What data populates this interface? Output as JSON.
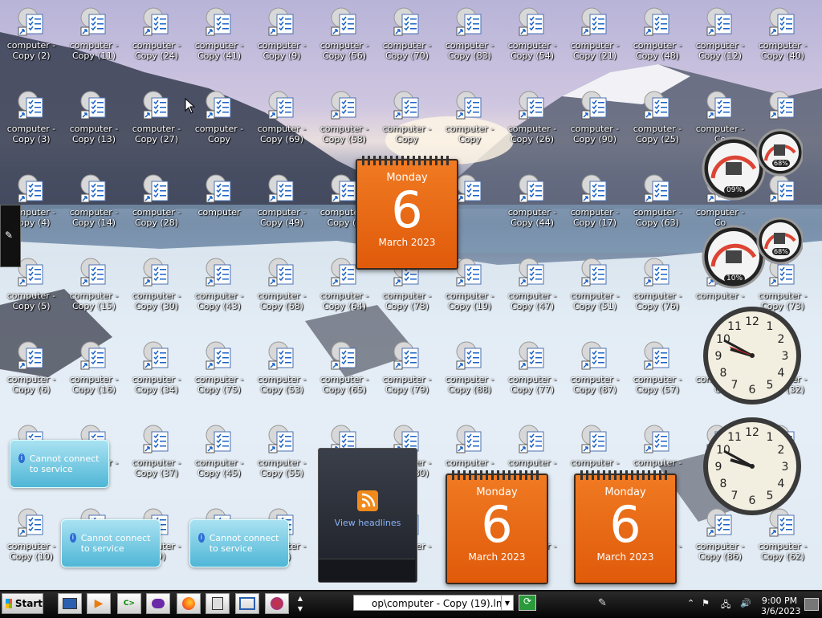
{
  "desktop": {
    "icons": [
      [
        "computer -\nCopy (2)",
        "computer -\nCopy (11)",
        "computer -\nCopy (24)",
        "computer -\nCopy (41)",
        "computer -\nCopy (9)",
        "computer -\nCopy (56)",
        "computer -\nCopy (70)",
        "computer -\nCopy (83)",
        "computer -\nCopy (54)",
        "computer -\nCopy (21)",
        "computer -\nCopy (48)",
        "computer -\nCopy (12)",
        "computer -\nCopy (40)"
      ],
      [
        "computer -\nCopy (3)",
        "computer -\nCopy (13)",
        "computer -\nCopy (27)",
        "computer -\nCopy",
        "computer -\nCopy (69)",
        "computer -\nCopy (58)",
        "computer -\nCopy",
        "computer -\nCopy",
        "computer -\nCopy (26)",
        "computer -\nCopy (90)",
        "computer -\nCopy (25)",
        "computer -\nCo",
        ""
      ],
      [
        "computer -\nCopy (4)",
        "computer -\nCopy (14)",
        "computer -\nCopy (28)",
        "computer",
        "computer -\nCopy (49)",
        "computer -\nCopy (5",
        "",
        "",
        "computer -\nCopy (44)",
        "computer -\nCopy (17)",
        "computer -\nCopy (63)",
        "computer -\nCo",
        ""
      ],
      [
        "computer -\nCopy (5)",
        "computer -\nCopy (15)",
        "computer -\nCopy (30)",
        "computer -\nCopy (43)",
        "computer -\nCopy (68)",
        "computer -\nCopy (64)",
        "computer -\nCopy (78)",
        "computer -\nCopy (19)",
        "computer -\nCopy (47)",
        "computer -\nCopy (51)",
        "computer -\nCopy (76)",
        "computer -\n",
        "computer -\nCopy (73)"
      ],
      [
        "computer -\nCopy (6)",
        "computer -\nCopy (16)",
        "computer -\nCopy (34)",
        "computer -\nCopy (75)",
        "computer -\nCopy (53)",
        "computer -\nCopy (65)",
        "computer -\nCopy (79)",
        "computer -\nCopy (88)",
        "computer -\nCopy (77)",
        "computer -\nCopy (87)",
        "computer -\nCopy (57)",
        "computer -\nCo",
        "computer -\nCopy (32)"
      ],
      [
        "",
        "computer -\n8)",
        "computer -\nCopy (37)",
        "computer -\nCopy (45)",
        "computer -\nCopy (55)",
        "",
        "computer -\nCopy (80)",
        "computer -\n",
        "computer -\n",
        "computer -\n",
        "computer -\n",
        "",
        ""
      ],
      [
        "computer -\nCopy (10)",
        "",
        "computer -\n(39)",
        "",
        "computer -\n(42)",
        "",
        "computer -\n(31)",
        "",
        "computer -\n2)",
        "",
        "computer -\n",
        "computer -\nCopy (86)",
        "computer -\nCopy (62)"
      ]
    ]
  },
  "calendars": [
    {
      "day_name": "Monday",
      "day": "6",
      "month_year": "March 2023"
    },
    {
      "day_name": "Monday",
      "day": "6",
      "month_year": "March 2023"
    },
    {
      "day_name": "Monday",
      "day": "6",
      "month_year": "March 2023"
    }
  ],
  "meters": [
    {
      "cpu": "09%",
      "mem": "68%"
    },
    {
      "cpu": "10%",
      "mem": "68%"
    }
  ],
  "notices": [
    "Cannot connect to service",
    "Cannot connect to service",
    "Cannot connect to service"
  ],
  "feed": {
    "label": "View headlines"
  },
  "taskbar": {
    "start_label": "Start",
    "address_value": "op\\computer - Copy (19).lnk",
    "time": "9:00 PM",
    "date": "3/6/2023"
  }
}
